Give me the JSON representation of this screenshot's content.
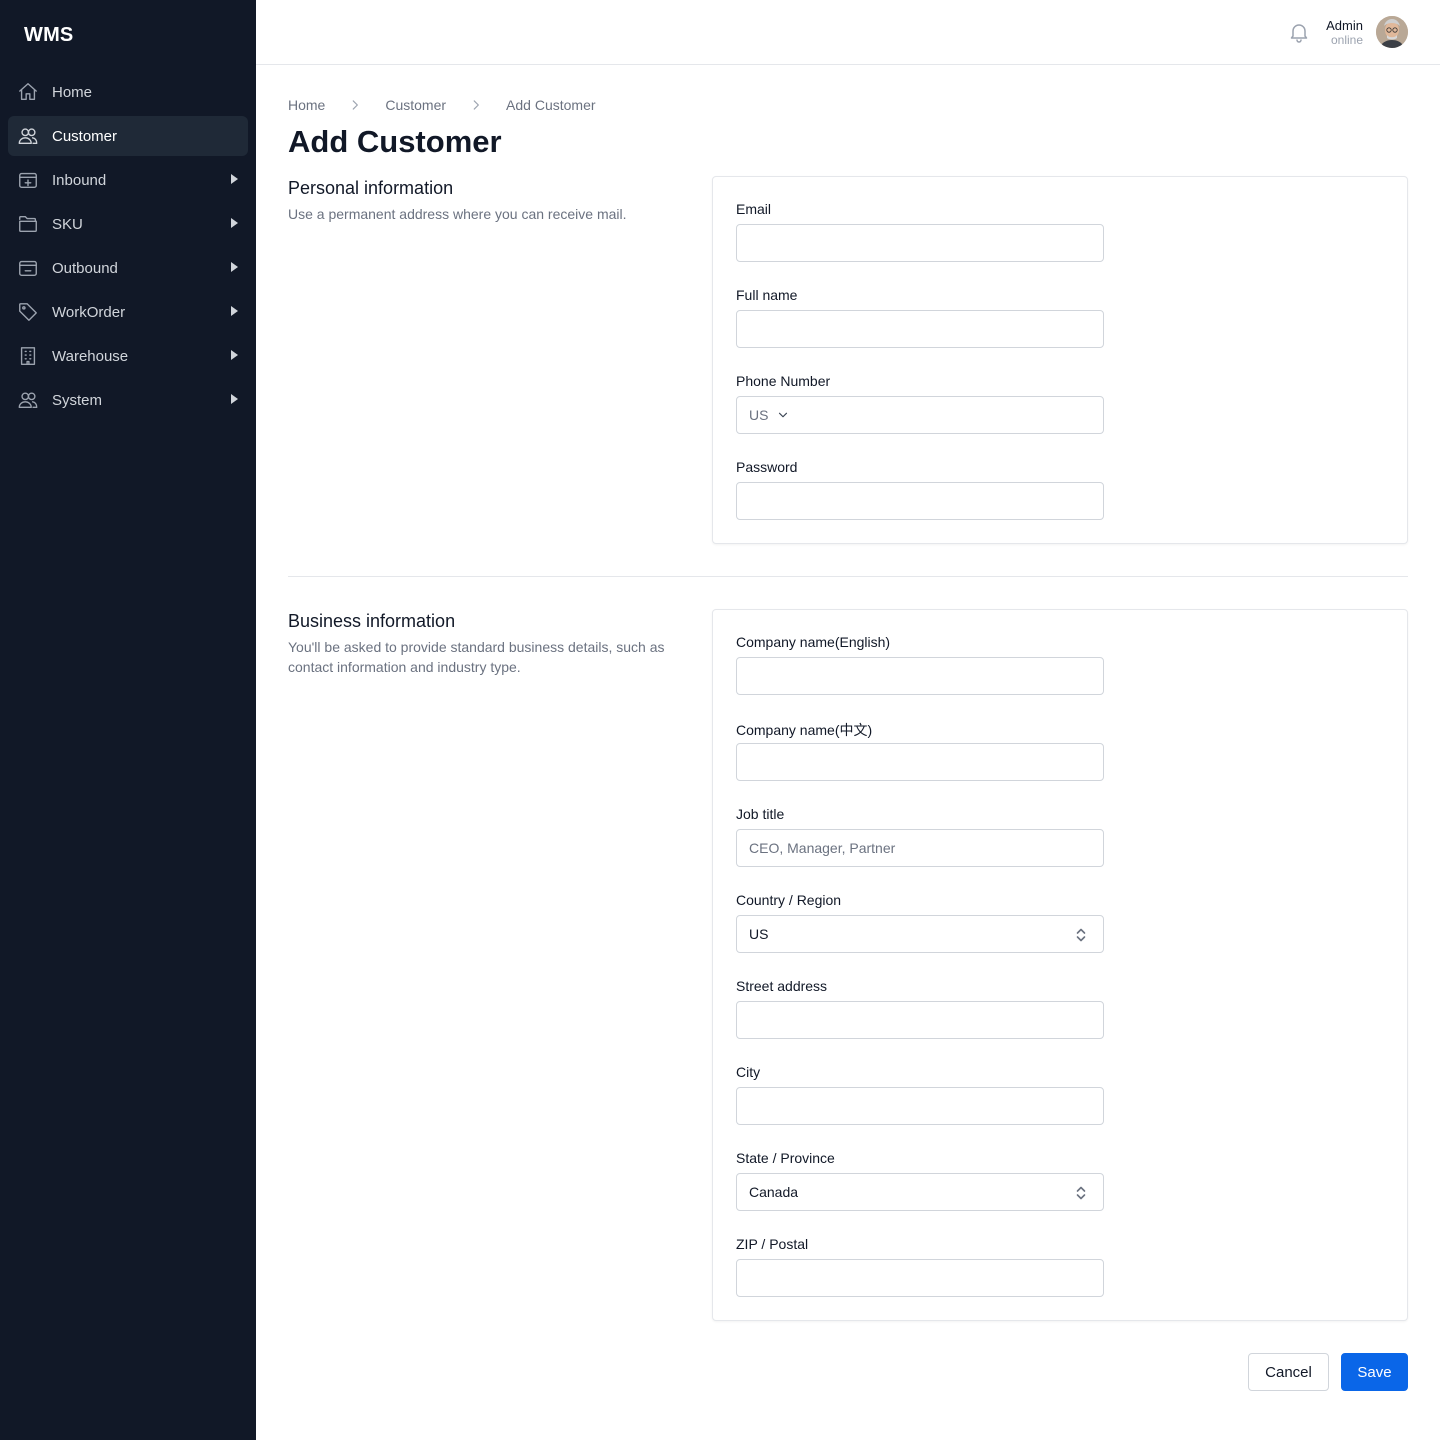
{
  "app": {
    "logo": "WMS"
  },
  "sidebar": {
    "items": [
      {
        "label": "Home",
        "icon": "home-icon",
        "active": false,
        "expandable": false
      },
      {
        "label": "Customer",
        "icon": "users-icon",
        "active": true,
        "expandable": false
      },
      {
        "label": "Inbound",
        "icon": "inbox-plus-icon",
        "active": false,
        "expandable": true
      },
      {
        "label": "SKU",
        "icon": "folder-icon",
        "active": false,
        "expandable": true
      },
      {
        "label": "Outbound",
        "icon": "inbox-minus-icon",
        "active": false,
        "expandable": true
      },
      {
        "label": "WorkOrder",
        "icon": "tag-icon",
        "active": false,
        "expandable": true
      },
      {
        "label": "Warehouse",
        "icon": "building-icon",
        "active": false,
        "expandable": true
      },
      {
        "label": "System",
        "icon": "users-icon",
        "active": false,
        "expandable": true
      }
    ]
  },
  "header": {
    "user_name": "Admin",
    "user_status": "online"
  },
  "breadcrumb": [
    "Home",
    "Customer",
    "Add Customer"
  ],
  "page_title": "Add Customer",
  "personal": {
    "title": "Personal information",
    "description": "Use a permanent address where you can receive mail.",
    "email_label": "Email",
    "email_value": "",
    "fullname_label": "Full name",
    "fullname_value": "",
    "phone_label": "Phone Number",
    "phone_country": "US",
    "phone_value": "",
    "password_label": "Password",
    "password_value": ""
  },
  "business": {
    "title": "Business information",
    "description": "You'll be asked to provide standard business details, such as contact information and industry type.",
    "company_en_label": "Company name(English)",
    "company_zh_label": "Company name(中文)",
    "job_title_label": "Job title",
    "job_title_placeholder": "CEO, Manager, Partner",
    "country_label": "Country / Region",
    "country_value": "US",
    "street_label": "Street address",
    "city_label": "City",
    "state_label": "State / Province",
    "state_value": "Canada",
    "zip_label": "ZIP / Postal"
  },
  "actions": {
    "cancel_label": "Cancel",
    "save_label": "Save"
  },
  "colors": {
    "sidebar_bg": "#111827",
    "active_item_bg": "#1f2937",
    "primary": "#0a66e8"
  }
}
